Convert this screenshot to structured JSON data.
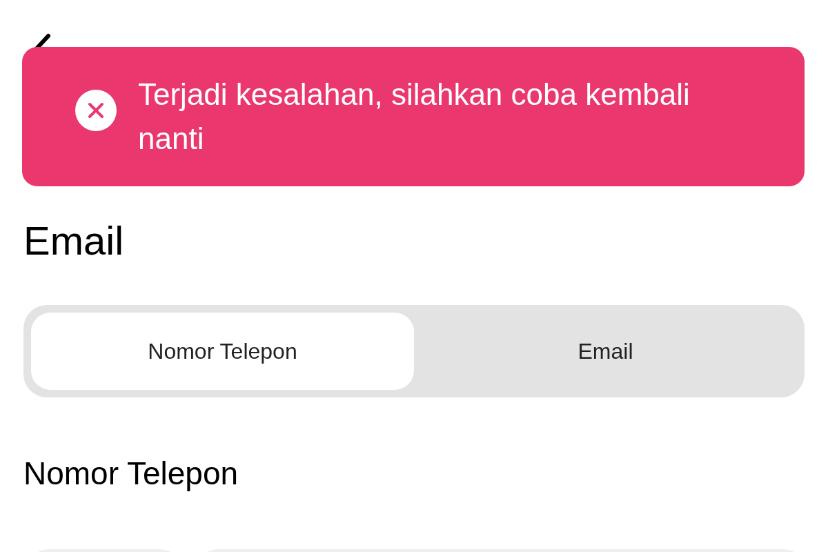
{
  "toast": {
    "kind": "error",
    "message": "Terjadi kesalahan, silahkan coba kembali nanti"
  },
  "heading": "Email",
  "tabs": [
    {
      "label": "Nomor Telepon",
      "selected": true
    },
    {
      "label": "Email",
      "selected": false
    }
  ],
  "field_label": "Nomor Telepon"
}
